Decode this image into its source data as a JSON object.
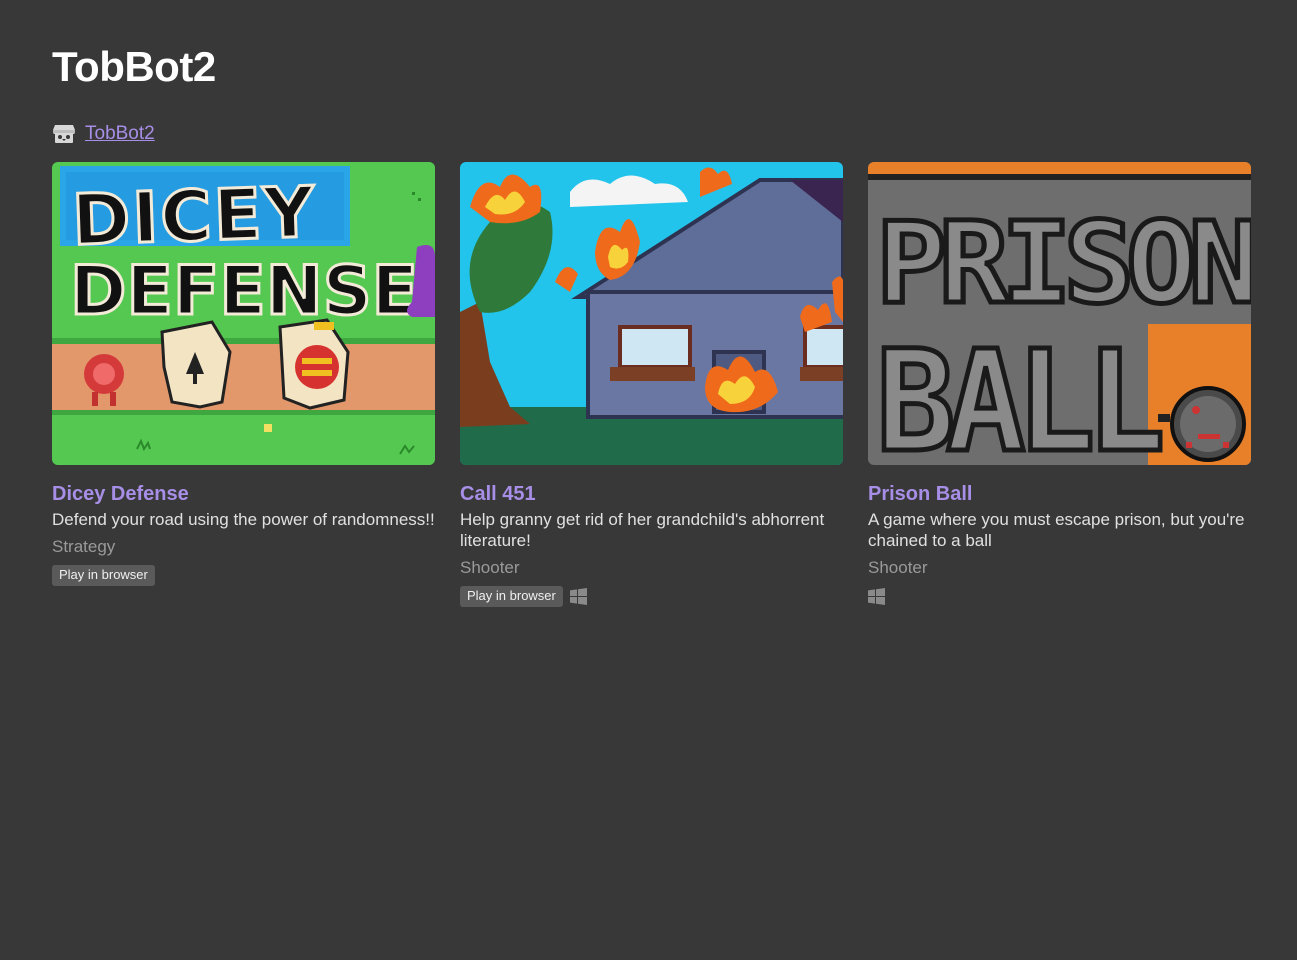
{
  "page": {
    "title": "TobBot2",
    "profile_link": "TobBot2",
    "profile_icon": "itchio-icon",
    "accent_color": "#a78ee6"
  },
  "games": [
    {
      "title": "Dicey Defense",
      "description": "Defend your road using the power of randomness!!",
      "genre": "Strategy",
      "browser_label": "Play in browser",
      "platforms": [
        "browser"
      ]
    },
    {
      "title": "Call 451",
      "description": "Help granny get rid of her grandchild's abhorrent literature!",
      "genre": "Shooter",
      "browser_label": "Play in browser",
      "platforms": [
        "browser",
        "windows"
      ]
    },
    {
      "title": "Prison Ball",
      "description": "A game where you must escape prison, but you're chained to a ball",
      "genre": "Shooter",
      "platforms": [
        "windows"
      ]
    }
  ],
  "thumbnails": {
    "dicey": {
      "line1": "DICEY",
      "line2": "DEFENSE"
    },
    "prison": {
      "line1": "PRISON",
      "line2": "BALL"
    }
  }
}
